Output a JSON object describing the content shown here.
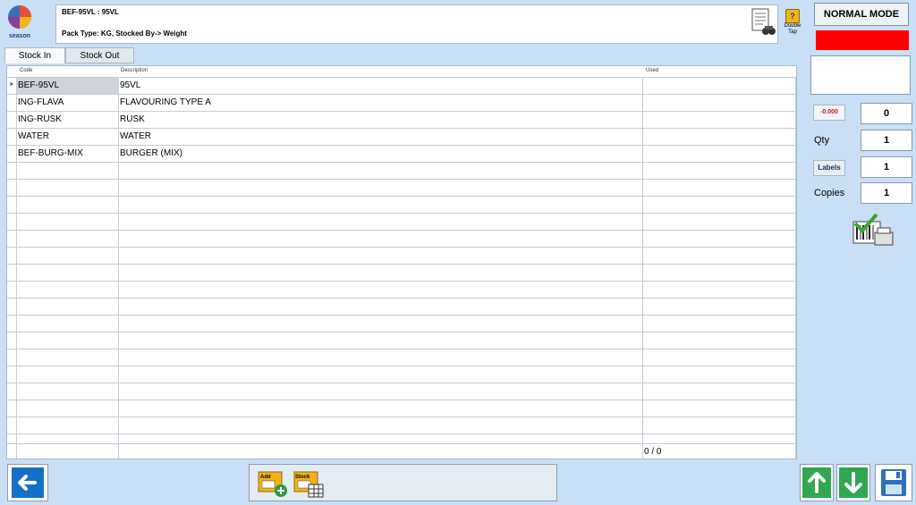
{
  "logo": {
    "text": "season"
  },
  "header": {
    "title": "BEF-95VL : 95VL",
    "subtitle": "Pack Type: KG,    Stocked By-> Weight",
    "help_label": "Double Tap",
    "help_icon": "?"
  },
  "right_panel": {
    "mode": "NORMAL MODE",
    "status_color": "#ff0000",
    "neg_value": "-0.000",
    "neg_field": "0",
    "qty_label": "Qty",
    "qty_value": "1",
    "labels_button": "Labels",
    "labels_value": "1",
    "copies_label": "Copies",
    "copies_value": "1"
  },
  "tabs": [
    {
      "label": "Stock In"
    },
    {
      "label": "Stock Out"
    }
  ],
  "grid": {
    "columns": [
      "Code",
      "Description",
      "Used"
    ],
    "rows": [
      {
        "code": "BEF-95VL",
        "description": "95VL",
        "used": ""
      },
      {
        "code": "ING-FLAVA",
        "description": "FLAVOURING TYPE A",
        "used": ""
      },
      {
        "code": "ING-RUSK",
        "description": "RUSK",
        "used": ""
      },
      {
        "code": "WATER",
        "description": "WATER",
        "used": ""
      },
      {
        "code": "BEF-BURG-MIX",
        "description": "BURGER  (MIX)",
        "used": ""
      }
    ],
    "footer_count": "0 / 0"
  },
  "bottom": {
    "add_label": "Add",
    "stock_label": "Stock"
  }
}
